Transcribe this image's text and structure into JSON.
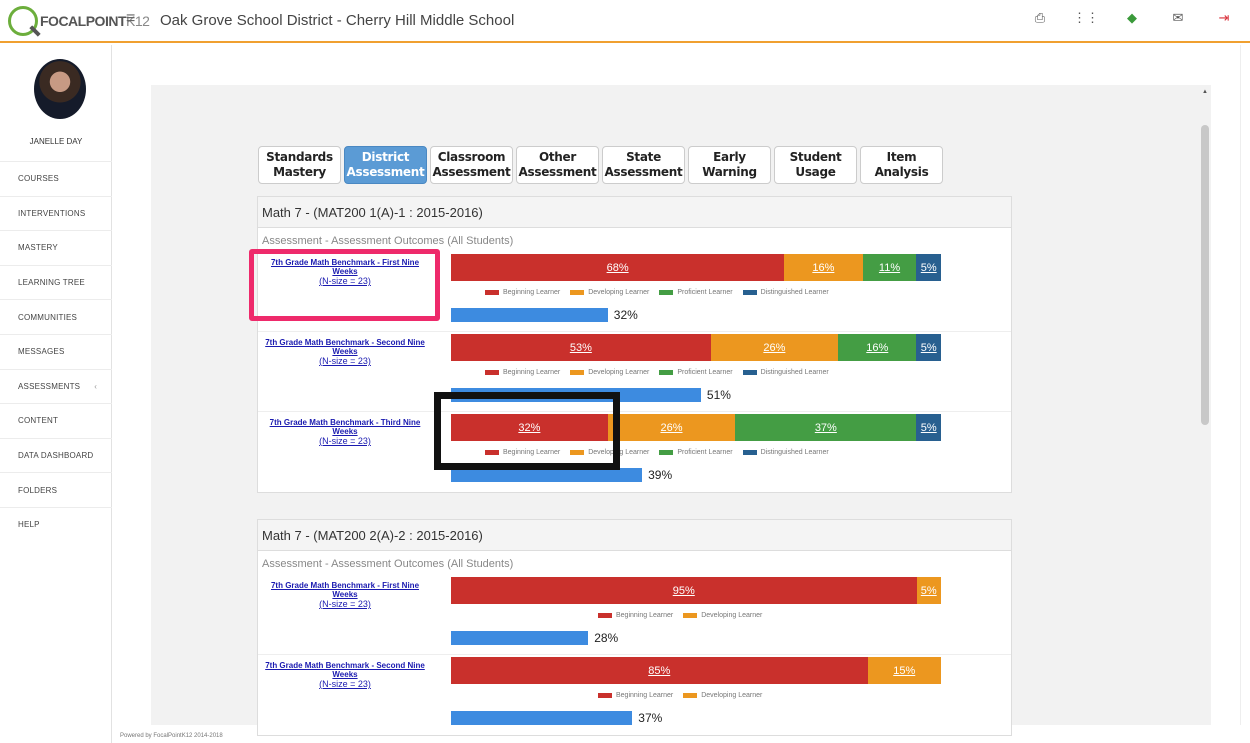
{
  "app": {
    "logo_text": "FOCALPOINT",
    "logo_suffix": "K12",
    "district_title": "Oak Grove School District - Cherry Hill Middle School",
    "footer": "Powered by FocalPointK12 2014-2018"
  },
  "user": {
    "name": "JANELLE DAY"
  },
  "nav": [
    {
      "label": "COURSES"
    },
    {
      "label": "INTERVENTIONS"
    },
    {
      "label": "MASTERY"
    },
    {
      "label": "LEARNING TREE"
    },
    {
      "label": "COMMUNITIES"
    },
    {
      "label": "MESSAGES"
    },
    {
      "label": "ASSESSMENTS",
      "chevron": "‹"
    },
    {
      "label": "CONTENT"
    },
    {
      "label": "DATA DASHBOARD"
    },
    {
      "label": "FOLDERS"
    },
    {
      "label": "HELP"
    }
  ],
  "top_icons": [
    "print-icon",
    "grid-icon",
    "notification-icon",
    "mail-icon",
    "logout-icon"
  ],
  "tabs": [
    {
      "line1": "Standards",
      "line2": "Mastery"
    },
    {
      "line1": "District",
      "line2": "Assessment",
      "active": true
    },
    {
      "line1": "Classroom",
      "line2": "Assessment"
    },
    {
      "line1": "Other",
      "line2": "Assessment"
    },
    {
      "line1": "State",
      "line2": "Assessment"
    },
    {
      "line1": "Early",
      "line2": "Warning"
    },
    {
      "line1": "Student",
      "line2": "Usage"
    },
    {
      "line1": "Item",
      "line2": "Analysis"
    }
  ],
  "colors": {
    "beginning": "#c9302c",
    "developing": "#ec971f",
    "proficient": "#449d44",
    "distinguished": "#286090",
    "progress": "#3d8be0"
  },
  "legend_labels": [
    "Beginning Learner",
    "Developing Learner",
    "Proficient Learner",
    "Distinguished Learner"
  ],
  "cards": [
    {
      "title": "Math 7 - (MAT200 1(A)-1 : 2015-2016)",
      "subtitle": "Assessment - Assessment Outcomes (All Students)",
      "rows": [
        {
          "title": "7th Grade Math Benchmark - First Nine Weeks",
          "nsize": "(N-size = 23)",
          "segments": [
            68,
            16,
            11,
            5
          ],
          "labels": [
            "68%",
            "16%",
            "11%",
            "5%"
          ],
          "progress": 32,
          "progress_label": "32%"
        },
        {
          "title": "7th Grade Math Benchmark - Second Nine Weeks",
          "nsize": "(N-size = 23)",
          "segments": [
            53,
            26,
            16,
            5
          ],
          "labels": [
            "53%",
            "26%",
            "16%",
            "5%"
          ],
          "progress": 51,
          "progress_label": "51%"
        },
        {
          "title": "7th Grade Math Benchmark - Third Nine Weeks",
          "nsize": "(N-size = 23)",
          "segments": [
            32,
            26,
            37,
            5
          ],
          "labels": [
            "32%",
            "26%",
            "37%",
            "5%"
          ],
          "progress": 39,
          "progress_label": "39%"
        }
      ]
    },
    {
      "title": "Math 7 - (MAT200 2(A)-2 : 2015-2016)",
      "subtitle": "Assessment - Assessment Outcomes (All Students)",
      "rows": [
        {
          "title": "7th Grade Math Benchmark - First Nine Weeks",
          "nsize": "(N-size = 23)",
          "segments": [
            95,
            5
          ],
          "labels": [
            "95%",
            "5%"
          ],
          "progress": 28,
          "progress_label": "28%"
        },
        {
          "title": "7th Grade Math Benchmark - Second Nine Weeks",
          "nsize": "(N-size = 23)",
          "segments": [
            85,
            15
          ],
          "labels": [
            "85%",
            "15%"
          ],
          "progress": 37,
          "progress_label": "37%"
        }
      ]
    }
  ]
}
